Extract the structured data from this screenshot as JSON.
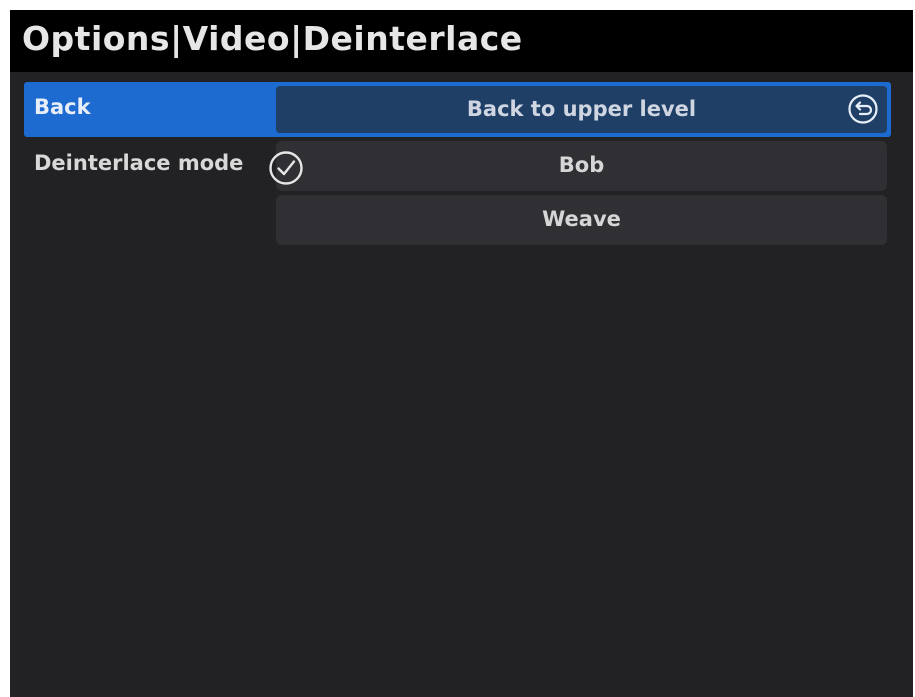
{
  "header": {
    "title": "Options|Video|Deinterlace"
  },
  "menu": {
    "back": {
      "label": "Back",
      "value": "Back to upper level",
      "icon": "back-arrow-icon"
    },
    "deinterlace_mode": {
      "label": "Deinterlace mode",
      "selected_icon": "checkmark-circle-icon",
      "options": [
        {
          "label": "Bob",
          "selected": true
        },
        {
          "label": "Weave",
          "selected": false
        }
      ]
    }
  },
  "colors": {
    "background": "#222124",
    "title_bar": "#000000",
    "highlight": "#1d6ad0",
    "value_box": "#303034",
    "text": "#d8d8d8"
  }
}
